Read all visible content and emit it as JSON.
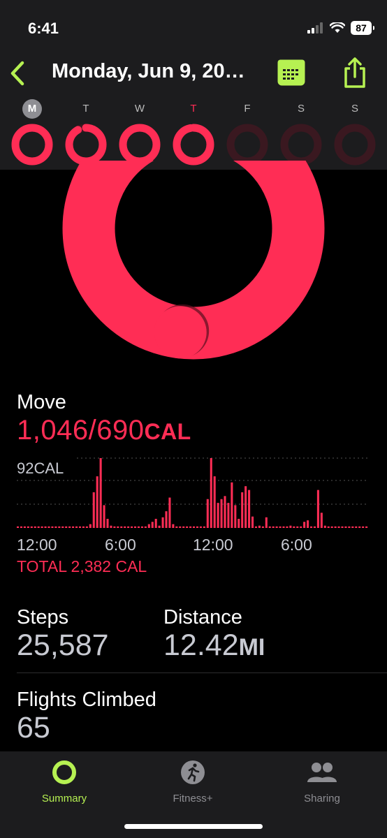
{
  "status": {
    "time": "6:41",
    "battery": "87"
  },
  "header": {
    "date_title": "Monday, Jun 9, 20…"
  },
  "week": [
    {
      "letter": "M",
      "selected": true,
      "today": false,
      "progress": 1.52
    },
    {
      "letter": "T",
      "selected": false,
      "today": false,
      "progress": 0.92
    },
    {
      "letter": "W",
      "selected": false,
      "today": false,
      "progress": 1.15
    },
    {
      "letter": "T",
      "selected": false,
      "today": true,
      "progress": 0.97
    },
    {
      "letter": "F",
      "selected": false,
      "today": false,
      "progress": 0
    },
    {
      "letter": "S",
      "selected": false,
      "today": false,
      "progress": 0
    },
    {
      "letter": "S",
      "selected": false,
      "today": false,
      "progress": 0
    }
  ],
  "move": {
    "label": "Move",
    "value": "1,046/690",
    "unit": "CAL",
    "progress": 1.52
  },
  "chart_data": {
    "type": "bar",
    "top_label": "92CAL",
    "x_tick_labels": [
      "12:00",
      "6:00",
      "12:00",
      "6:00"
    ],
    "values": [
      2,
      2,
      2,
      2,
      2,
      2,
      2,
      2,
      2,
      2,
      2,
      2,
      2,
      2,
      2,
      2,
      2,
      2,
      2,
      2,
      2,
      5,
      47,
      68,
      92,
      30,
      12,
      3,
      2,
      2,
      2,
      2,
      2,
      2,
      2,
      2,
      2,
      2,
      5,
      8,
      12,
      3,
      14,
      22,
      40,
      5,
      2,
      2,
      2,
      2,
      2,
      2,
      2,
      2,
      2,
      38,
      92,
      68,
      33,
      38,
      42,
      33,
      60,
      30,
      12,
      47,
      55,
      50,
      15,
      2,
      3,
      2,
      14,
      2,
      2,
      2,
      2,
      2,
      2,
      3,
      2,
      2,
      2,
      8,
      10,
      2,
      2,
      50,
      20,
      3,
      2,
      2,
      2,
      2,
      2,
      2,
      2,
      2,
      2,
      2,
      2,
      2
    ],
    "ylim": [
      0,
      92
    ],
    "color": "#ff2d55"
  },
  "total": "TOTAL 2,382 CAL",
  "stats": {
    "steps_label": "Steps",
    "steps_value": "25,587",
    "distance_label": "Distance",
    "distance_value": "12.42",
    "distance_unit": "MI",
    "flights_label": "Flights Climbed",
    "flights_value": "65"
  },
  "tabs": [
    {
      "label": "Summary",
      "icon": "activity-ring-icon",
      "active": true
    },
    {
      "label": "Fitness+",
      "icon": "runner-icon",
      "active": false
    },
    {
      "label": "Sharing",
      "icon": "people-icon",
      "active": false
    }
  ],
  "colors": {
    "move_ring": "#ff2d55",
    "accent": "#b6f152",
    "header_bg": "#1c1c1e"
  }
}
